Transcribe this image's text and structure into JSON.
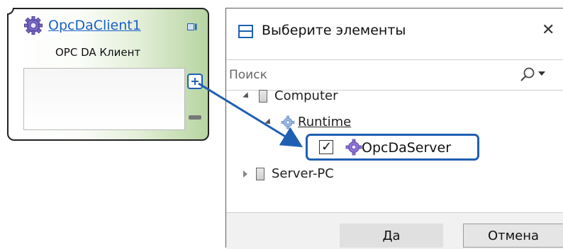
{
  "component": {
    "name": "OpcDaClient1",
    "type_label": "OPC DA Клиент",
    "icons": [
      "gear-icon",
      "minimize-icon",
      "plus-icon",
      "minus-icon"
    ]
  },
  "dialog": {
    "title": "Выберите элементы",
    "close_glyph": "✕",
    "search": {
      "placeholder": "Поиск",
      "value": ""
    },
    "tree": [
      {
        "label": "Computer",
        "expanded": true,
        "icon": "server-icon",
        "children": [
          {
            "label": "Runtime",
            "expanded": true,
            "icon": "gear-icon",
            "children": [
              {
                "label": "OpcDaServer",
                "checked": true,
                "icon": "gear-icon"
              }
            ]
          }
        ]
      },
      {
        "label": "Server-PC",
        "expanded": false,
        "icon": "server-icon"
      }
    ],
    "buttons": {
      "ok": "Да",
      "cancel": "Отмена"
    }
  },
  "colors": {
    "accent": "#1f5fb3",
    "link": "#1a5fc8",
    "block_gradient_end": "#b7d4a2"
  }
}
